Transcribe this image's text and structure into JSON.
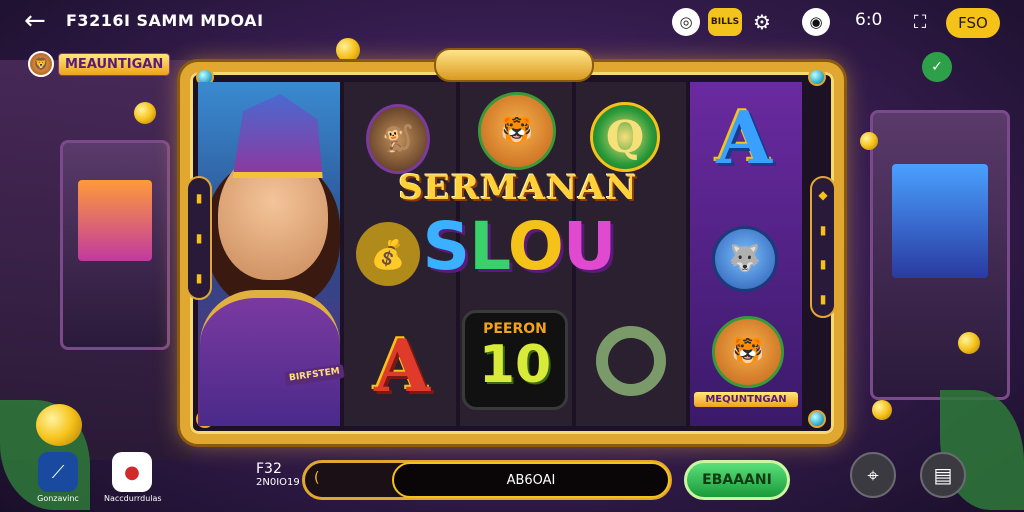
{
  "header": {
    "back_label": "←",
    "title": "F3216I SAMM MDOAI",
    "counter": "6:0",
    "currency_label": "FSO",
    "bills_label": "BILLS"
  },
  "icons": {
    "back": "back-arrow-icon",
    "settings": "gear-icon",
    "sound": "sound-icon",
    "grid": "grid-icon",
    "crosshair": "crosshair-icon",
    "chest": "chest-icon"
  },
  "brand": {
    "name": "MEAUNTIGAN"
  },
  "reels": {
    "headline": "SERMANAN",
    "logo_letters": [
      "S",
      "L",
      "O",
      "U"
    ],
    "logo_colors": [
      "#3ab0ff",
      "#3ad06a",
      "#f5c21a",
      "#e04ad0"
    ],
    "hero_tag": "BIRFSTEM",
    "prize_label": "PEERON",
    "prize_value": "10",
    "col5_tag": "MEQUNTNGAN",
    "letter_a": "A",
    "letter_q": "Q"
  },
  "bottom": {
    "apps": [
      {
        "label": "Gonzavinc"
      },
      {
        "label": "Naccdurrdulas"
      }
    ],
    "balance_top": "F32",
    "balance_bottom": "2N0IO19",
    "bar_mark": "(",
    "bar_label": "AB6OAI",
    "spin_label": "EBAAANI"
  },
  "colors": {
    "gold": "#e0a830",
    "accent_green": "#1a9a3a",
    "yellow": "#f5c21a"
  }
}
